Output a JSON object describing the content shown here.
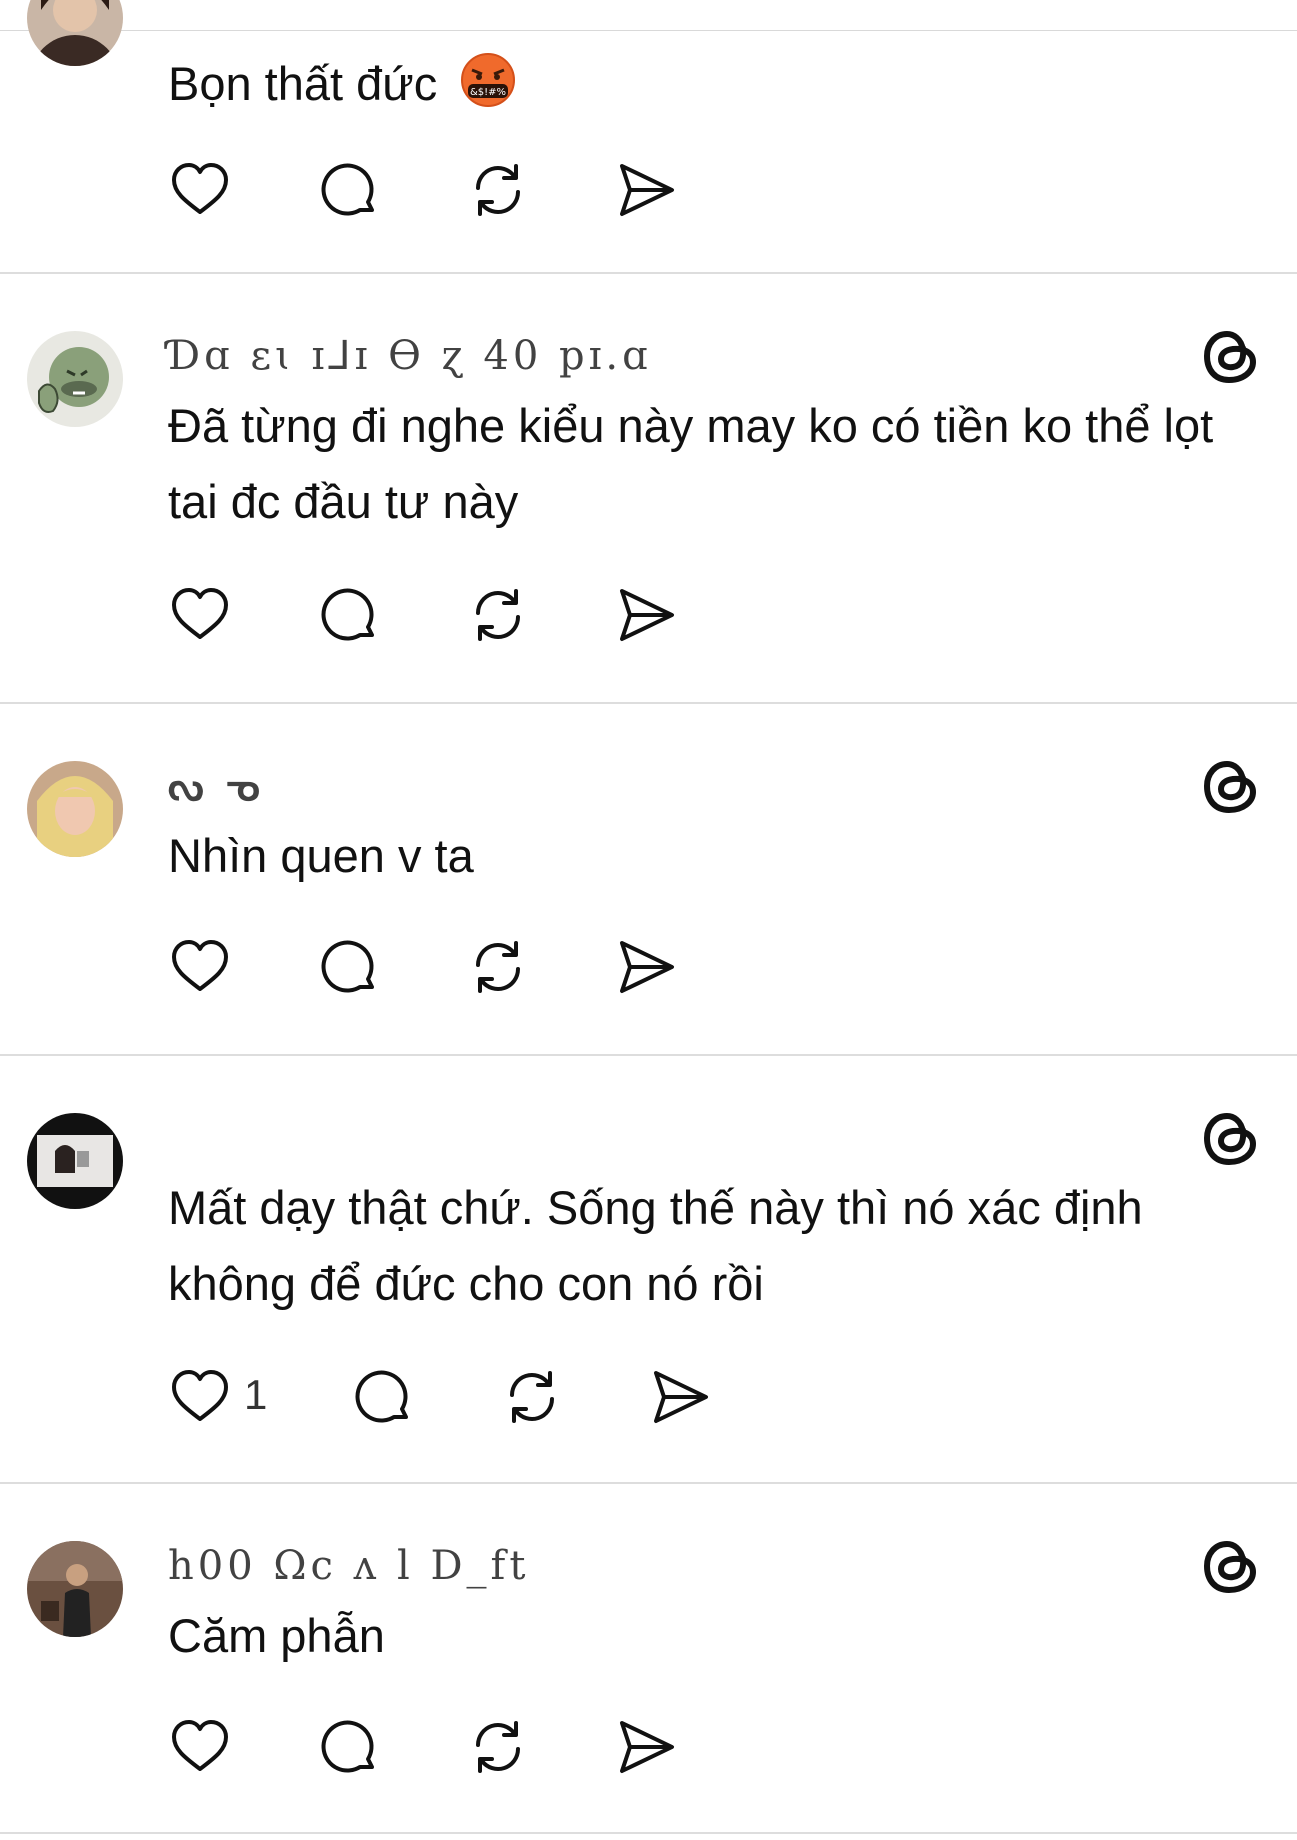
{
  "posts": [
    {
      "username": "",
      "text": "Bọn thất đức",
      "emoji_icon": "cursing-face-icon",
      "likes": "",
      "has_threads_icon": false
    },
    {
      "username": "Ɗɑ ɛɩ ɪ⅃ɪ ϴ ɀ 40 рɪ.ɑ",
      "text": "Đã từng đi nghe kiểu này may ko có tiền ko thể lọt tai đc đầu tư này",
      "likes": "",
      "has_threads_icon": true
    },
    {
      "username": "ᔓ    ᓀ",
      "text": "Nhìn quen v ta",
      "likes": "",
      "has_threads_icon": true
    },
    {
      "username": "",
      "text": "Mất dạy thật chứ. Sống thế này thì nó xác định không để đức cho con nó rồi",
      "likes": "1",
      "has_threads_icon": true
    },
    {
      "username": "h00 Ωc  ʌ   l D_ft",
      "text": "Căm phẫn",
      "likes": "",
      "has_threads_icon": true
    }
  ],
  "icons": {
    "like": "heart-icon",
    "reply": "comment-bubble-icon",
    "repost": "repost-icon",
    "share": "send-icon",
    "brand": "threads-logo-icon"
  }
}
